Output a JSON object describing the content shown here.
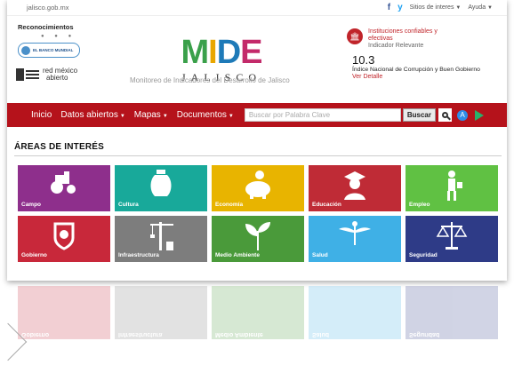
{
  "topbar": {
    "domain": "jalisco.gob.mx",
    "facebook": "f",
    "twitter": "y",
    "sites": "Sitios de interes",
    "help": "Ayuda"
  },
  "header": {
    "recognitions_title": "Reconocimientos",
    "banco_mundial": "EL BANCO MUNDIAL",
    "red_mexico": "red méxico",
    "abierto": "abierto",
    "logo_m": "M",
    "logo_i": "I",
    "logo_d": "D",
    "logo_e": "E",
    "logo_sub": "JALISCO",
    "subtitle": "Monitoreo de Indicadores del Desarrollo de Jalisco"
  },
  "indicator": {
    "category_line1": "Instituciones confiables y",
    "category_line2": "efectivas",
    "relevance": "Indicador Relevante",
    "value": "10.3",
    "name": "Índice Nacional de Corrupción y Buen Gobierno",
    "link": "Ver Detalle"
  },
  "nav": {
    "items": [
      {
        "label": "Inicio"
      },
      {
        "label": "Datos abiertos"
      },
      {
        "label": "Mapas"
      },
      {
        "label": "Documentos"
      }
    ],
    "search_placeholder": "Buscar por Palabra Clave",
    "search_button": "Buscar"
  },
  "areas": {
    "title": "ÁREAS DE INTERÉS",
    "tiles": [
      {
        "label": "Campo",
        "color": "#8e2f8c"
      },
      {
        "label": "Cultura",
        "color": "#18a99a"
      },
      {
        "label": "Economía",
        "color": "#e8b400"
      },
      {
        "label": "Educación",
        "color": "#bf2b36"
      },
      {
        "label": "Empleo",
        "color": "#60c143"
      },
      {
        "label": "Gobierno",
        "color": "#c8283a"
      },
      {
        "label": "Infraestructura",
        "color": "#7d7d7d"
      },
      {
        "label": "Medio Ambiente",
        "color": "#4a9a3a"
      },
      {
        "label": "Salud",
        "color": "#3fb0e6"
      },
      {
        "label": "Seguridad",
        "color": "#2e3b87"
      }
    ]
  }
}
